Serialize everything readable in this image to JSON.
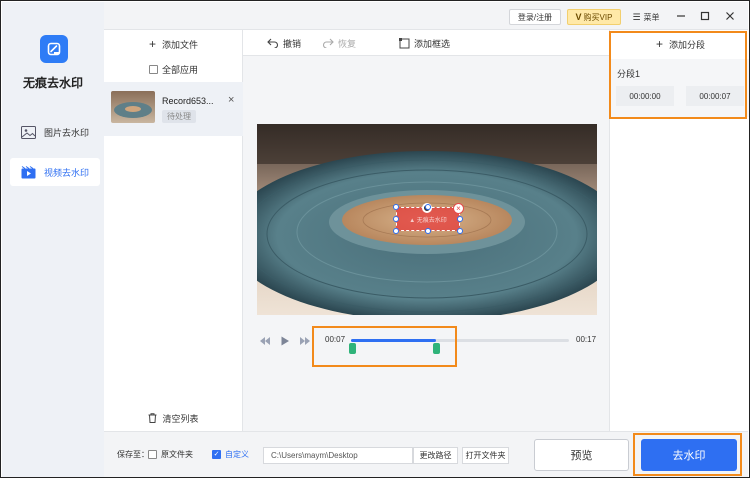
{
  "app": {
    "title": "无痕去水印"
  },
  "sidebar": {
    "items": [
      {
        "label": "图片去水印",
        "icon": "image-icon",
        "active": false
      },
      {
        "label": "视频去水印",
        "icon": "video-icon",
        "active": true
      }
    ]
  },
  "topbar": {
    "login_label": "登录/注册",
    "vip_label": "购买VIP",
    "menu_label": "菜单"
  },
  "files": {
    "add_label": "添加文件",
    "apply_all_label": "全部应用",
    "items": [
      {
        "name": "Record653...",
        "status": "待处理"
      }
    ],
    "clear_label": "清空列表"
  },
  "editor": {
    "undo_label": "撤销",
    "redo_label": "恢复",
    "add_box_label": "添加框选"
  },
  "timeline": {
    "current": "00:07",
    "total": "00:17",
    "progress": 0.39
  },
  "segments": {
    "add_label": "添加分段",
    "items": [
      {
        "label": "分段1",
        "start": "00:00:00",
        "end": "00:00:07"
      }
    ]
  },
  "bottom": {
    "save_label": "保存至：",
    "source_folder_label": "原文件夹",
    "custom_label": "自定义",
    "path": "C:\\Users\\maym\\Desktop",
    "change_path_label": "更改路径",
    "open_folder_label": "打开文件夹",
    "preview_label": "预览",
    "remove_label": "去水印"
  },
  "colors": {
    "accent": "#2e6ff2",
    "highlight": "#f28a1b",
    "marker": "#2fb37a"
  }
}
